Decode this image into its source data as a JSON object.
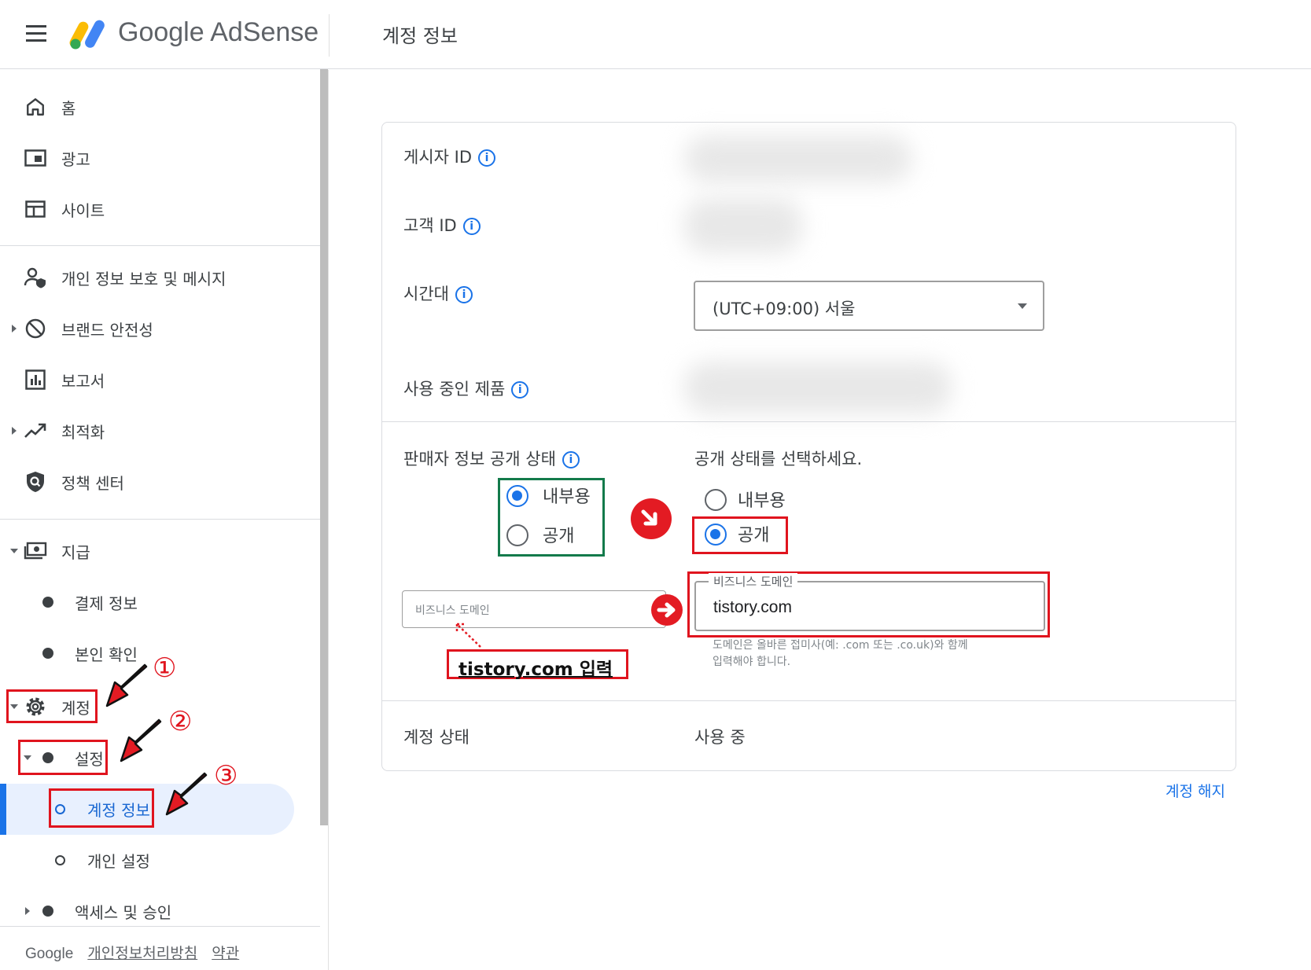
{
  "header": {
    "menu_icon": "hamburger-menu-icon",
    "logo_text": "Google AdSense",
    "page_title": "계정 정보"
  },
  "sidebar": {
    "items": [
      {
        "label": "홈",
        "icon": "home-icon"
      },
      {
        "label": "광고",
        "icon": "ads-icon"
      },
      {
        "label": "사이트",
        "icon": "sites-icon"
      },
      {
        "label": "개인 정보 보호 및 메시지",
        "icon": "privacy-messaging-icon"
      },
      {
        "label": "브랜드 안전성",
        "icon": "block-icon"
      },
      {
        "label": "보고서",
        "icon": "reports-icon"
      },
      {
        "label": "최적화",
        "icon": "trending-up-icon"
      },
      {
        "label": "정책 센터",
        "icon": "policy-shield-icon"
      },
      {
        "label": "지급",
        "icon": "payments-icon"
      },
      {
        "label": "결제 정보"
      },
      {
        "label": "본인 확인"
      },
      {
        "label": "계정",
        "icon": "gear-icon"
      },
      {
        "label": "설정"
      },
      {
        "label": "계정 정보"
      },
      {
        "label": "개인 설정"
      },
      {
        "label": "액세스 및 승인"
      }
    ],
    "footer": {
      "google": "Google",
      "privacy": "개인정보처리방침",
      "terms": "약관"
    }
  },
  "annotations": {
    "step1": "①",
    "step2": "②",
    "step3": "③",
    "tistory_input": "tistory.com 입력"
  },
  "account_info": {
    "publisher_id_label": "게시자 ID",
    "customer_id_label": "고객 ID",
    "timezone_label": "시간대",
    "timezone_value": "(UTC+09:00) 서울",
    "products_label": "사용 중인 제품",
    "seller_info_label": "판매자 정보 공개 상태",
    "before": {
      "internal": "내부용",
      "public": "공개",
      "selected": "내부용",
      "domain_placeholder": "비즈니스 도메인"
    },
    "after": {
      "prompt": "공개 상태를 선택하세요.",
      "internal": "내부용",
      "public": "공개",
      "selected": "공개",
      "domain_label": "비즈니스 도메인",
      "domain_value": "tistory.com",
      "domain_hint_1": "도메인은 올바른 접미사(예: .com 또는 .co.uk)와 함께",
      "domain_hint_2": "입력해야 합니다."
    },
    "account_status_label": "계정 상태",
    "account_status_value": "사용 중",
    "close_account": "계정 해지"
  },
  "colors": {
    "accent": "#1a73e8",
    "annotation_red": "#e0141e",
    "annotation_green": "#137a4b",
    "active_nav_bg": "#e8f0fe"
  }
}
